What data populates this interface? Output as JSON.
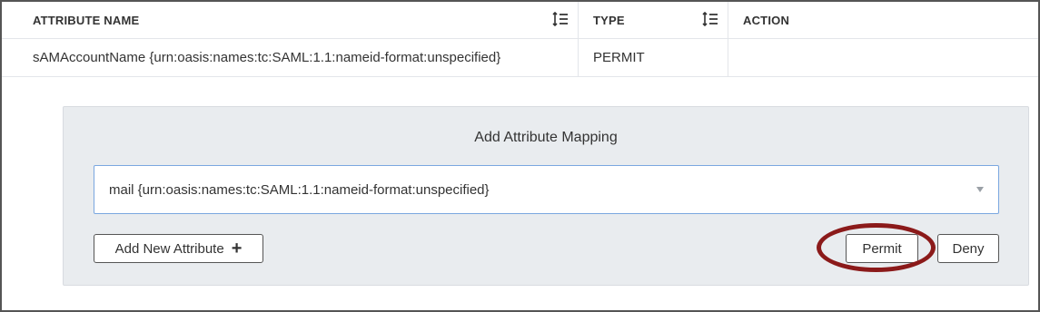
{
  "table": {
    "headers": {
      "attribute_name": "ATTRIBUTE NAME",
      "type": "TYPE",
      "action": "ACTION"
    },
    "rows": [
      {
        "attribute_name": "sAMAccountName {urn:oasis:names:tc:SAML:1.1:nameid-format:unspecified}",
        "type": "PERMIT",
        "action": ""
      }
    ]
  },
  "panel": {
    "title": "Add Attribute Mapping",
    "select_value": "mail {urn:oasis:names:tc:SAML:1.1:nameid-format:unspecified}",
    "add_button_label": "Add New Attribute",
    "add_button_icon": "plus-icon",
    "permit_label": "Permit",
    "deny_label": "Deny"
  },
  "colors": {
    "highlight": "#8b1a1a",
    "select_border": "#7aa7e0",
    "panel_bg": "#e9ecef"
  }
}
